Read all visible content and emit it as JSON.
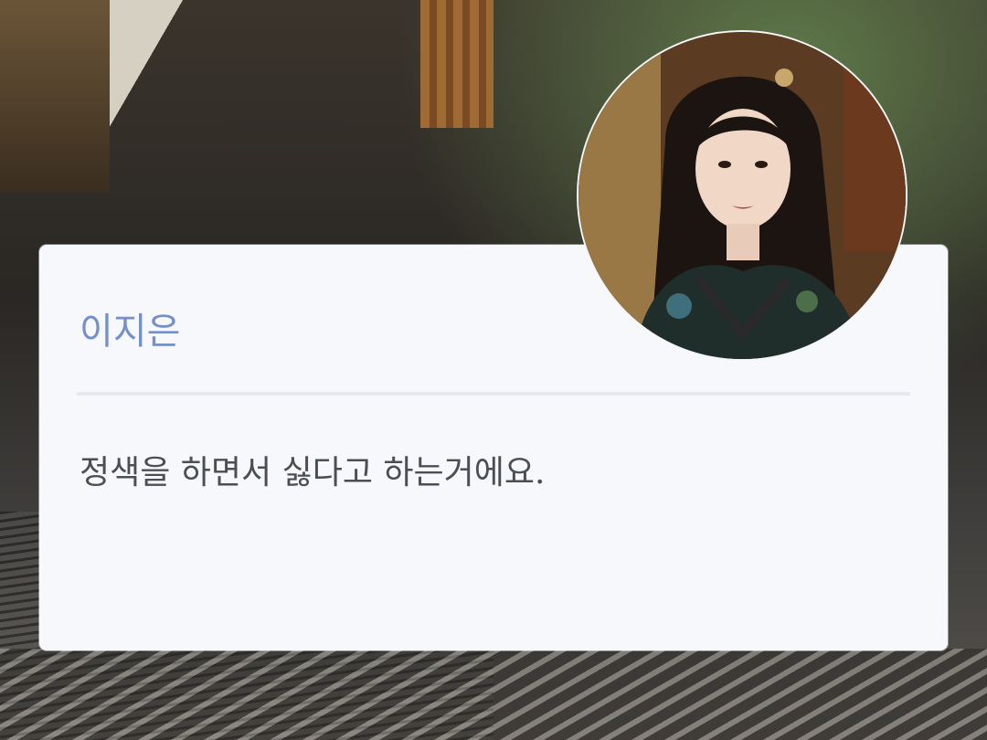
{
  "dialogue_box": {
    "speaker_name": "이지은",
    "message": "정색을 하면서 싫다고 하는거에요."
  },
  "avatar": {
    "icon": "character-portrait"
  },
  "colors": {
    "speaker_name": "#7590c9",
    "message_text": "#4b4f55",
    "card_background": "#f6f8fb",
    "divider": "#e5e9ef"
  }
}
